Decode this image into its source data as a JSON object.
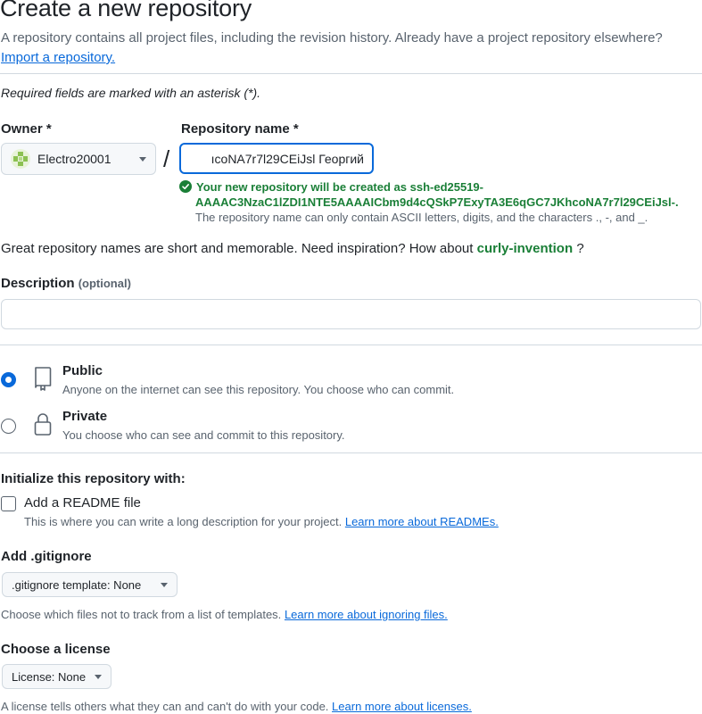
{
  "page": {
    "title": "Create a new repository",
    "intro_text": "A repository contains all project files, including the revision history. Already have a project repository elsewhere?",
    "import_link": "Import a repository.",
    "required_note": "Required fields are marked with an asterisk (*)."
  },
  "owner": {
    "label": "Owner *",
    "value": "Electro20001",
    "icon": "identicon-avatar"
  },
  "separator": "/",
  "repository_name": {
    "label": "Repository name *",
    "value": "ıcoNA7r7l29CEiJsl Георгий"
  },
  "validation": {
    "success_line1": "Your new repository will be created as ssh-ed25519-",
    "success_line2": "AAAAC3NzaC1lZDI1NTE5AAAAICbm9d4cQSkP7ExyTA3E6qGC7JKhcoNA7r7l29CEiJsl-.",
    "ascii_note": "The repository name can only contain ASCII letters, digits, and the characters ., -, and _."
  },
  "inspiration": {
    "text": "Great repository names are short and memorable. Need inspiration? How about",
    "suggestion": "curly-invention",
    "suffix": "?"
  },
  "description": {
    "label": "Description",
    "optional": "(optional)",
    "value": ""
  },
  "visibility": {
    "options": [
      {
        "title": "Public",
        "desc": "Anyone on the internet can see this repository. You choose who can commit.",
        "checked": true,
        "icon": "repo-icon"
      },
      {
        "title": "Private",
        "desc": "You choose who can see and commit to this repository.",
        "checked": false,
        "icon": "lock-icon"
      }
    ]
  },
  "initialize": {
    "title": "Initialize this repository with:",
    "readme_label": "Add a README file",
    "readme_desc": "This is where you can write a long description for your project.",
    "readme_link": "Learn more about READMEs.",
    "readme_checked": false
  },
  "gitignore": {
    "title": "Add .gitignore",
    "select_label": ".gitignore template: None",
    "help": "Choose which files not to track from a list of templates.",
    "help_link": "Learn more about ignoring files."
  },
  "license": {
    "title": "Choose a license",
    "select_label": "License: None",
    "help": "A license tells others what they can and can't do with your code.",
    "help_link": "Learn more about licenses."
  },
  "colors": {
    "accent": "#0969da",
    "success": "#1a7f37",
    "muted": "#59636e",
    "border": "#d1d9e0"
  }
}
